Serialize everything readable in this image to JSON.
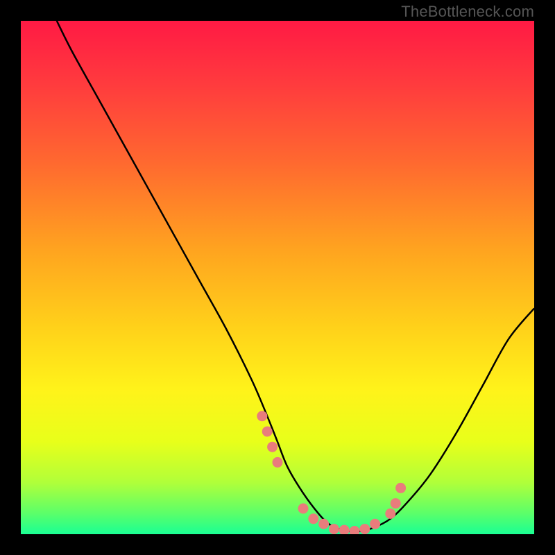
{
  "watermark": "TheBottleneck.com",
  "chart_data": {
    "type": "line",
    "title": "",
    "xlabel": "",
    "ylabel": "",
    "xlim": [
      0,
      100
    ],
    "ylim": [
      0,
      100
    ],
    "notes": "Background is a vertical gradient from red (top) through orange/yellow to green (bottom). A single black curve descends from top-left, reaches a flat minimum ~60% across, then rises toward the right. Salmon-pink dots mark points near the valley.",
    "series": [
      {
        "name": "curve",
        "color": "#000000",
        "x": [
          7,
          10,
          15,
          20,
          25,
          30,
          35,
          40,
          45,
          48,
          50,
          52,
          55,
          58,
          60,
          62,
          65,
          68,
          72,
          76,
          80,
          85,
          90,
          95,
          100
        ],
        "y": [
          100,
          94,
          85,
          76,
          67,
          58,
          49,
          40,
          30,
          23,
          18,
          13,
          8,
          4,
          2,
          1,
          0.5,
          1,
          3,
          7,
          12,
          20,
          29,
          38,
          44
        ]
      }
    ],
    "scatter": {
      "name": "dots",
      "color": "#e97c7c",
      "x": [
        47,
        48,
        49,
        50,
        55,
        57,
        59,
        61,
        63,
        65,
        67,
        69,
        72,
        73,
        74
      ],
      "y": [
        23,
        20,
        17,
        14,
        5,
        3,
        2,
        1,
        0.8,
        0.6,
        1,
        2,
        4,
        6,
        9
      ]
    },
    "gradient_stops": [
      {
        "offset": 0.0,
        "color": "#ff1a44"
      },
      {
        "offset": 0.12,
        "color": "#ff3a3e"
      },
      {
        "offset": 0.28,
        "color": "#ff6a2f"
      },
      {
        "offset": 0.45,
        "color": "#ffa51f"
      },
      {
        "offset": 0.6,
        "color": "#ffd21a"
      },
      {
        "offset": 0.72,
        "color": "#fff31a"
      },
      {
        "offset": 0.82,
        "color": "#e8ff1a"
      },
      {
        "offset": 0.9,
        "color": "#b0ff3a"
      },
      {
        "offset": 0.96,
        "color": "#5aff6a"
      },
      {
        "offset": 1.0,
        "color": "#1aff94"
      }
    ]
  }
}
